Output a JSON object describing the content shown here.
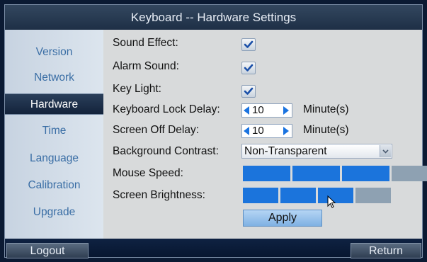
{
  "window": {
    "title": "Keyboard -- Hardware Settings"
  },
  "sidebar": {
    "items": [
      {
        "label": "Version"
      },
      {
        "label": "Network"
      },
      {
        "label": "Hardware",
        "active": true
      },
      {
        "label": "Time"
      },
      {
        "label": "Language"
      },
      {
        "label": "Calibration"
      },
      {
        "label": "Upgrade"
      }
    ]
  },
  "settings": {
    "sound_effect": {
      "label": "Sound Effect:",
      "checked": true
    },
    "alarm_sound": {
      "label": "Alarm Sound:",
      "checked": true
    },
    "key_light": {
      "label": "Key Light:",
      "checked": true
    },
    "keyboard_lock_delay": {
      "label": "Keyboard Lock Delay:",
      "value": "10",
      "unit": "Minute(s)"
    },
    "screen_off_delay": {
      "label": "Screen Off Delay:",
      "value": "10",
      "unit": "Minute(s)"
    },
    "background_contrast": {
      "label": "Background Contrast:",
      "value": "Non-Transparent"
    },
    "mouse_speed": {
      "label": "Mouse Speed:",
      "level": 3,
      "max": 4
    },
    "screen_brightness": {
      "label": "Screen Brightness:",
      "level": 3,
      "max": 4
    },
    "apply_label": "Apply"
  },
  "footer": {
    "logout_label": "Logout",
    "return_label": "Return"
  },
  "colors": {
    "accent": "#1b74dc",
    "slider_off": "#8ea1b2",
    "sidebar_text": "#3a6ea5"
  }
}
